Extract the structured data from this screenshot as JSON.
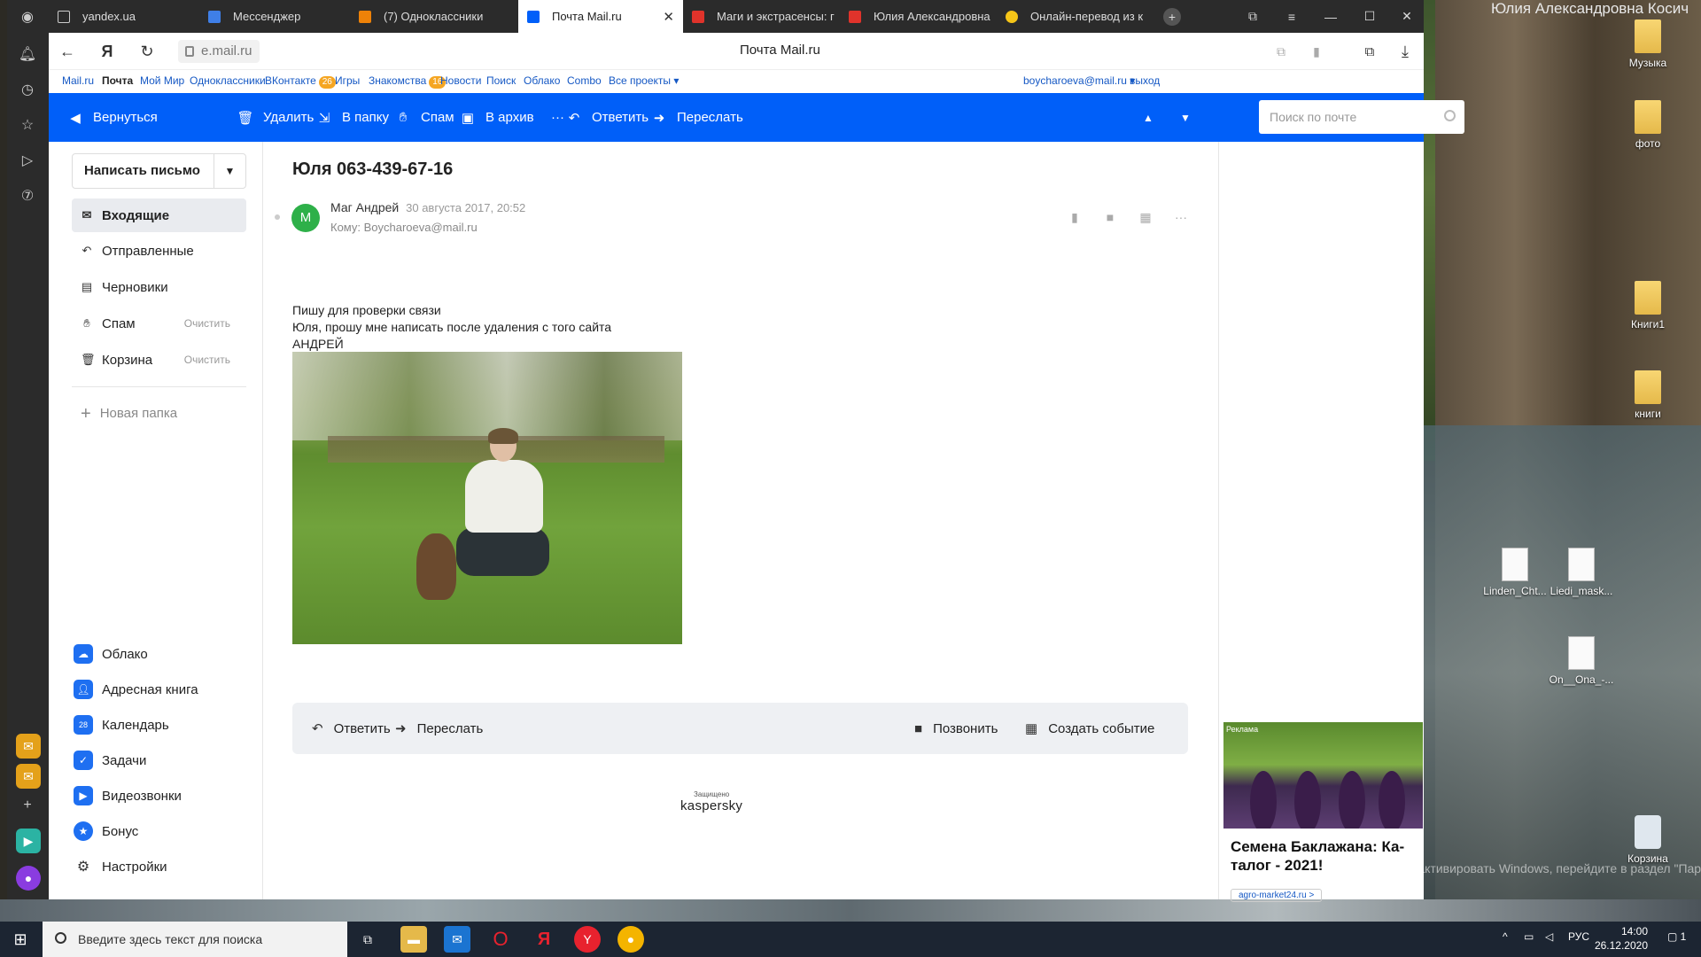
{
  "desktop": {
    "title_fragment": "Юлия Александровна Косич",
    "icons": [
      {
        "label": "Музыка",
        "kind": "folder"
      },
      {
        "label": "фото",
        "kind": "folder"
      },
      {
        "label": "Книги1",
        "kind": "folder"
      },
      {
        "label": "книги",
        "kind": "folder"
      },
      {
        "label": "Linden_Cht...",
        "kind": "doc"
      },
      {
        "label": "Liedi_mask...",
        "kind": "doc"
      },
      {
        "label": "On__Ona_-...",
        "kind": "doc"
      },
      {
        "label": "Корзина",
        "kind": "bin"
      }
    ],
    "activation_watermark": "Чтобы активировать Windows, перейдите в раздел \"Параметры\"."
  },
  "browser": {
    "tabs": [
      {
        "label": "yandex.ua",
        "color": "#ffffff"
      },
      {
        "label": "Мессенджер",
        "color": "#3f7fe7"
      },
      {
        "label": "(7) Одноклассники",
        "color": "#ee8208"
      },
      {
        "label": "Почта Mail.ru",
        "color": "#005ff9",
        "active": true
      },
      {
        "label": "Маги и экстрасенсы: г",
        "color": "#e0332b"
      },
      {
        "label": "Юлия Александровна",
        "color": "#e0332b"
      },
      {
        "label": "Онлайн-перевод из к",
        "color": "#f5c518"
      }
    ],
    "new_tab": "+",
    "url": "e.mail.ru",
    "page_title": "Почта Mail.ru",
    "yandex_logo": "Я"
  },
  "portal": {
    "links": [
      {
        "label": "Mail.ru"
      },
      {
        "label": "Почта",
        "current": true
      },
      {
        "label": "Мой Мир"
      },
      {
        "label": "Одноклассники"
      },
      {
        "label": "ВКонтакте",
        "badge": "26"
      },
      {
        "label": "Игры"
      },
      {
        "label": "Знакомства",
        "badge": "16"
      },
      {
        "label": "Новости"
      },
      {
        "label": "Поиск"
      },
      {
        "label": "Облако"
      },
      {
        "label": "Combo"
      },
      {
        "label": "Все проекты ▾"
      }
    ],
    "user": "boycharoeva@mail.ru ▾",
    "logout": "выход"
  },
  "toolbar": {
    "back": "Вернуться",
    "delete": "Удалить",
    "to_folder": "В папку",
    "spam": "Спам",
    "archive": "В архив",
    "more": "···",
    "reply": "Ответить",
    "forward": "Переслать",
    "search_placeholder": "Поиск по почте",
    "accent": "#005ff9"
  },
  "sidebar": {
    "compose": "Написать письмо",
    "folders": [
      {
        "label": "Входящие",
        "icon": "inbox-icon",
        "active": true
      },
      {
        "label": "Отправленные",
        "icon": "sent-icon"
      },
      {
        "label": "Черновики",
        "icon": "drafts-icon"
      },
      {
        "label": "Спам",
        "icon": "spam-icon",
        "action": "Очистить"
      },
      {
        "label": "Корзина",
        "icon": "trash-icon",
        "action": "Очистить"
      }
    ],
    "new_folder": "Новая папка",
    "services": [
      {
        "label": "Облако",
        "color": "#1e6ff1",
        "icon": "cloud-icon"
      },
      {
        "label": "Адресная книга",
        "color": "#1e6ff1",
        "icon": "contacts-icon"
      },
      {
        "label": "Календарь",
        "color": "#1e6ff1",
        "icon": "calendar-icon",
        "glyph": "28"
      },
      {
        "label": "Задачи",
        "color": "#1e6ff1",
        "icon": "tasks-icon"
      },
      {
        "label": "Видеозвонки",
        "color": "#1e6ff1",
        "icon": "video-icon"
      },
      {
        "label": "Бонус",
        "color": "#1e6ff1",
        "icon": "bonus-icon"
      },
      {
        "label": "Настройки",
        "color": "#ffffff",
        "icon": "gear-icon"
      }
    ]
  },
  "letter": {
    "subject": "Юля 063-439-67-16",
    "avatar_letter": "М",
    "sender": "Маг Андрей",
    "date": "30 августа 2017, 20:52",
    "to": "Кому: Boycharoeva@mail.ru",
    "body": [
      "Пишу для проверки связи",
      "Юля, прошу мне написать после удаления с того сайта",
      "АНДРЕЙ"
    ],
    "actions": {
      "reply": "Ответить",
      "forward": "Переслать",
      "call": "Позвонить",
      "event": "Создать событие"
    },
    "protected_by": "Защищено",
    "protector": "kaspersky"
  },
  "ad": {
    "tag": "Реклама",
    "title": "Семена Баклажана: Ка-талог - 2021!",
    "link": "agro-market24.ru >"
  },
  "taskbar": {
    "search_placeholder": "Введите здесь текст для поиска",
    "lang": "РУС",
    "time": "14:00",
    "date": "26.12.2020",
    "notifications": "1"
  }
}
